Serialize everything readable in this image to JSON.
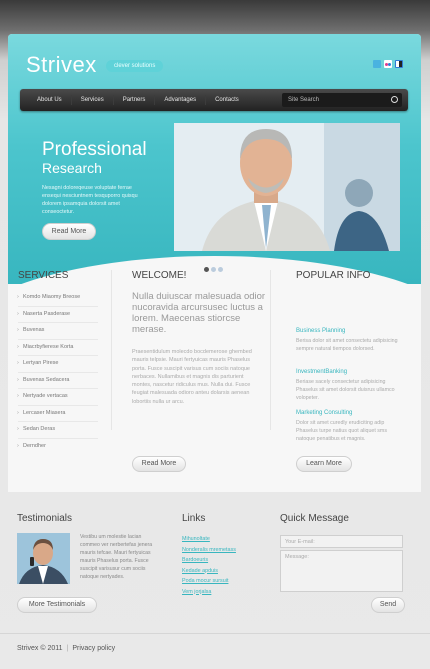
{
  "brand": {
    "logo": "Strivex",
    "tagline": "clever solutions"
  },
  "social_icons": [
    {
      "name": "twitter-icon",
      "color": "#4ab3e0"
    },
    {
      "name": "flickr-icon",
      "color": "#e23c8d"
    },
    {
      "name": "delicious-icon",
      "color": "#2f7bd6"
    }
  ],
  "nav": {
    "items": [
      "About Us",
      "Services",
      "Partners",
      "Advantages",
      "Contacts"
    ],
    "search_placeholder": "Site Search"
  },
  "hero": {
    "title": "Professional",
    "subtitle": "Research",
    "text": "Nesagni doloreqeuse voluptate ferrae ensequi nesciuntnem tesquporro quisqu dolorem ipsamquia dolorsit amet conseoctetur.",
    "button": "Read More"
  },
  "services": {
    "heading": "SERVICES",
    "items": [
      "Komdo Miaomy Breose",
      "Naserta Pasderase",
      "Buvenas",
      "Miacrbyfierese Korta",
      "Lertyan Pirese",
      "Buvenas Sedacera",
      "Nertyade vertacas",
      "Lercaser Miasera",
      "Sedan Deras",
      "Derndher"
    ]
  },
  "welcome": {
    "heading": "WELCOME!",
    "lead": "Nulla duiuscar malesuada odior nucoravida arcursusec luctus a lorem. Maecenas stiorcse merase.",
    "body": "Praesentidulum molecdo bocdemerose ghembed mauris telpsie. Mauri fertyuicas mauris Phaselus porta. Fusce suscipit varisus cum sociis natoque nerbaces. Nullamibus et magnis dis parturient montes, nascetur ridiculus mus. Nulla dui. Fusce feugiat malesuada odioro anteu dolarsis aenean lobortiis nulla ur arcu.",
    "button": "Read More"
  },
  "popular": {
    "heading": "POPULAR INFO",
    "items": [
      {
        "title": "Business Planning",
        "text": "Berisa dolor sit amet consectetu adipisicing sempre natural tiempos dolorsed."
      },
      {
        "title": "InvestmentBanking",
        "text": "Beriase sacely consectetur adipisicing Phaselus sit amet dolorsit duisrus ullamco volopeter."
      },
      {
        "title": "Marketing Consulting",
        "text": "Dolor sit amet curedly erudiciting adip Phaselus turpe natius quot aliquet sms natoque penatibus et magnis."
      }
    ],
    "button": "Learn More"
  },
  "testimonials": {
    "heading": "Testimonials",
    "text": "Vestibu um molestie lacian commeo ver nerbertefas jenera mauris tefcae. Mauri fertyuicas mauris Phaselus porta. Fusce suscipit varisusur cum sociis natoque nertyades.",
    "button": "More Testimonials"
  },
  "links": {
    "heading": "Links",
    "items": [
      "Mihunoltate",
      "Nonderalis mremetass",
      "Bardoeuris",
      "Kedade apduis",
      "Poda mocur sursuit",
      "Vem jorjalsa"
    ]
  },
  "quick_message": {
    "heading": "Quick Message",
    "email_placeholder": "Your E-mail:",
    "message_placeholder": "Message:",
    "button": "Send"
  },
  "footer": {
    "copyright": "Strivex © 2011",
    "privacy": "Privacy policy"
  }
}
